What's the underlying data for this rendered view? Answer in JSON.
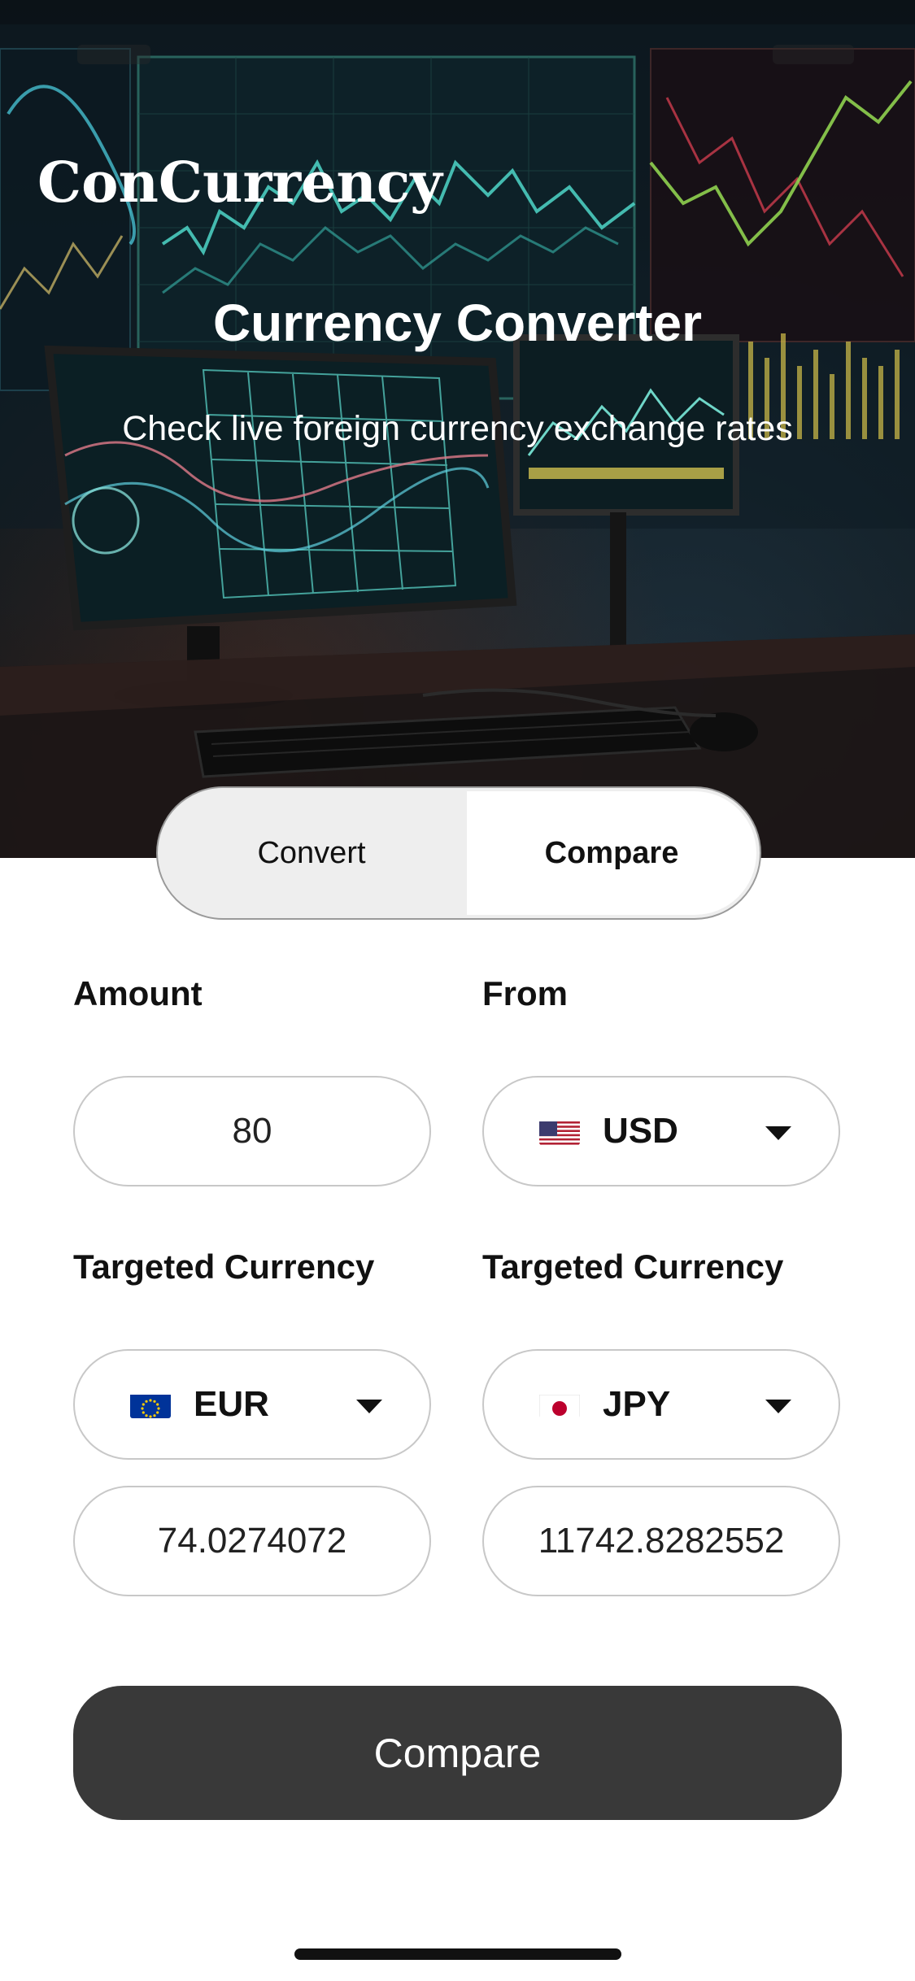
{
  "app": {
    "logo": "ConCurrency",
    "title": "Currency Converter",
    "subtitle": "Check live foreign currency exchange rates"
  },
  "tabs": [
    {
      "label": "Convert",
      "selected": false
    },
    {
      "label": "Compare",
      "selected": true
    }
  ],
  "form": {
    "amount_label": "Amount",
    "amount_value": "80",
    "from_label": "From",
    "from_currency": {
      "code": "USD",
      "flag": "us-flag-icon"
    },
    "target1_label": "Targeted Currency",
    "target1_currency": {
      "code": "EUR",
      "flag": "eu-flag-icon"
    },
    "target1_result": "74.0274072",
    "target2_label": "Targeted Currency",
    "target2_currency": {
      "code": "JPY",
      "flag": "jp-flag-icon"
    },
    "target2_result": "11742.8282552"
  },
  "actions": {
    "compare_label": "Compare"
  },
  "colors": {
    "button_bg": "#393939",
    "segment_bg": "#eeeeee",
    "segment_selected": "#ffffff",
    "field_border": "#c8c8c8"
  }
}
